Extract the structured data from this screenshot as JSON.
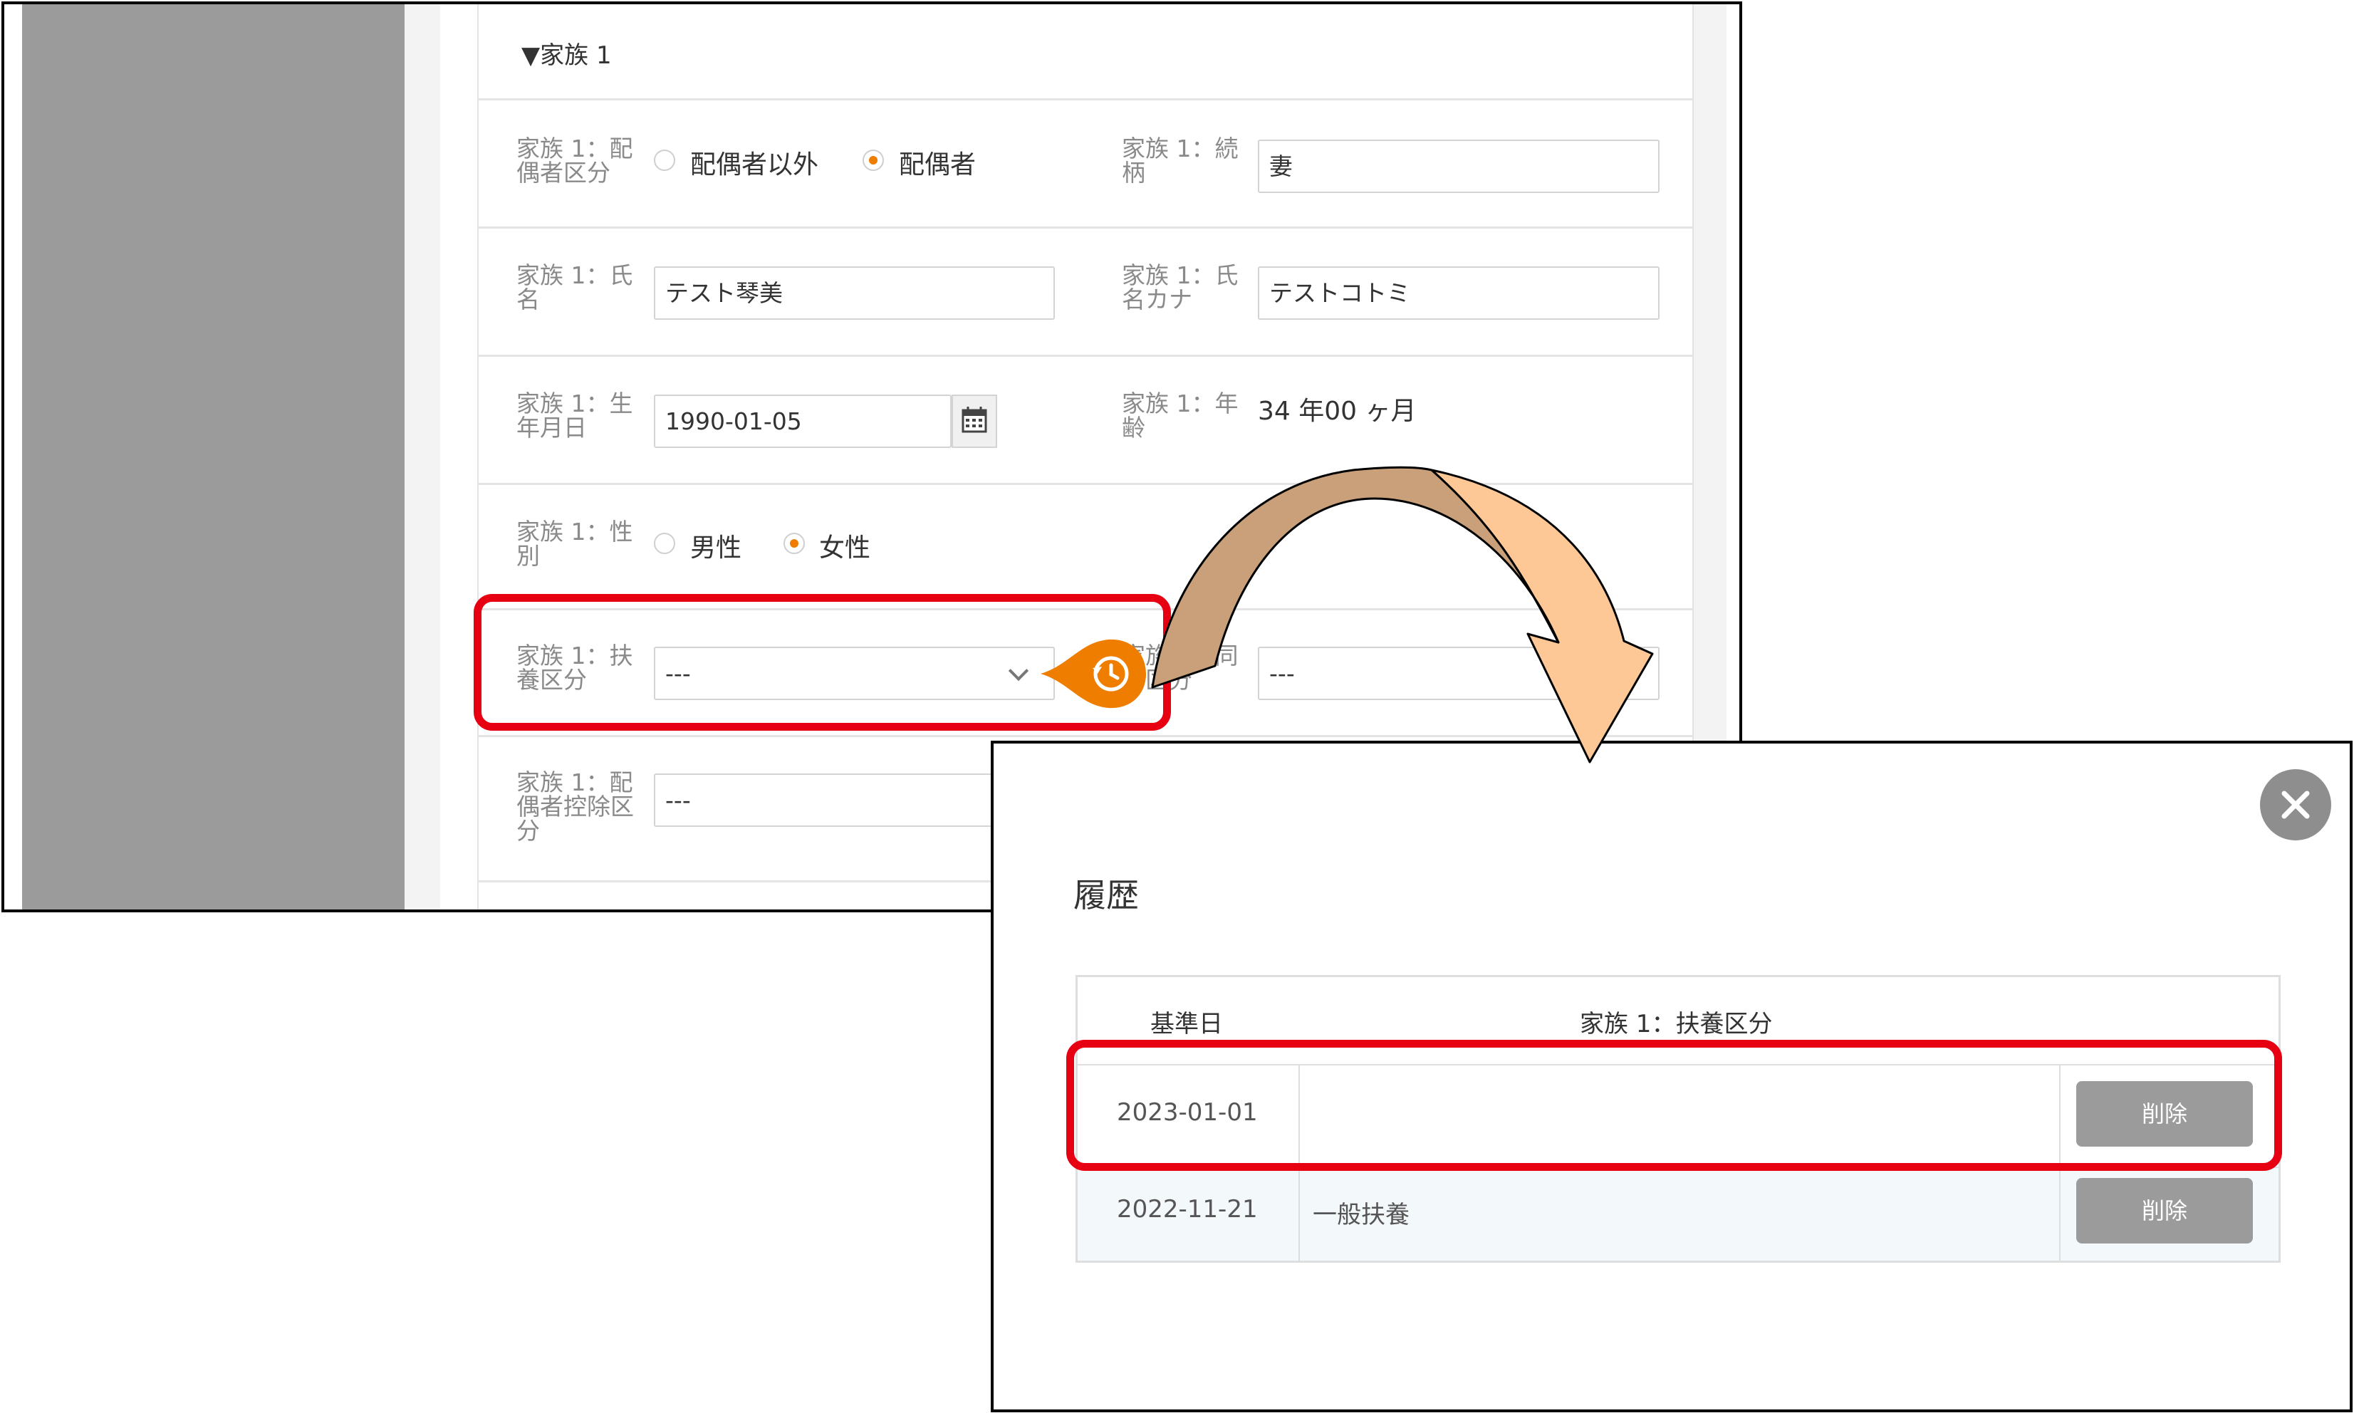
{
  "form": {
    "section_title": "▼家族 1",
    "spouse_type": {
      "label": "家族 1：配偶者区分",
      "options": [
        "配偶者以外",
        "配偶者"
      ],
      "selected": "配偶者"
    },
    "relationship": {
      "label": "家族 1：続柄",
      "value": "妻"
    },
    "name": {
      "label": "家族 1：氏名",
      "value": "テスト琴美"
    },
    "name_kana": {
      "label": "家族 1：氏名カナ",
      "value": "テストコトミ"
    },
    "birthdate": {
      "label": "家族 1：生年月日",
      "value": "1990-01-05"
    },
    "age": {
      "label": "家族 1：年齢",
      "value": "34 年00 ヶ月"
    },
    "gender": {
      "label": "家族 1：性別",
      "options": [
        "男性",
        "女性"
      ],
      "selected": "女性"
    },
    "dependent_type": {
      "label": "家族 1：扶養区分",
      "value": "---"
    },
    "cohabitation": {
      "label": "家族 1：同居区分",
      "value": "---"
    },
    "spouse_deduction": {
      "label": "家族 1：配偶者控除区分",
      "value": "---"
    }
  },
  "history_modal": {
    "title": "履歴",
    "columns": [
      "基準日",
      "家族 1：扶養区分"
    ],
    "rows": [
      {
        "date": "2023-01-01",
        "value": "",
        "action": "削除"
      },
      {
        "date": "2022-11-21",
        "value": "一般扶養",
        "action": "削除"
      }
    ]
  },
  "colors": {
    "highlight": "#e60012",
    "accent_orange": "#ee7d00",
    "arrow_dark": "#c9a07a",
    "arrow_light": "#fdc895"
  },
  "icons": [
    "calendar-icon",
    "chevron-down-icon",
    "history-icon",
    "close-icon"
  ]
}
